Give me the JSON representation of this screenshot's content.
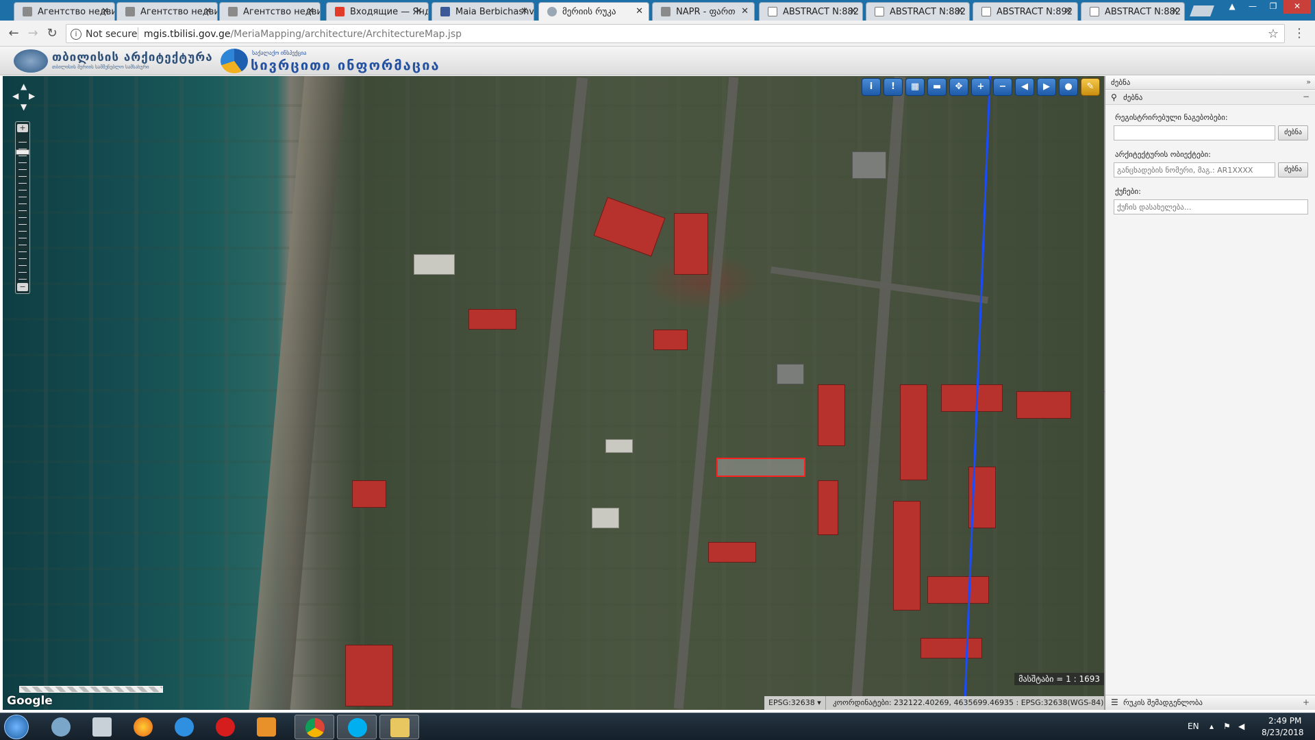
{
  "browser": {
    "tabs": [
      {
        "label": "Агентство недви",
        "icon": "site-icon"
      },
      {
        "label": "Агентство недви",
        "icon": "site-icon"
      },
      {
        "label": "Агентство недви",
        "icon": "site-icon"
      },
      {
        "label": "Входящие — Янд",
        "icon": "yandex-mail-icon"
      },
      {
        "label": "Maia Berbichashv",
        "icon": "facebook-icon"
      },
      {
        "label": "მერიის რუკა",
        "icon": "globe-icon",
        "active": true
      },
      {
        "label": "NAPR - ფართ",
        "icon": "napr-icon"
      },
      {
        "label": "ABSTRACT N:882",
        "icon": "document-icon"
      },
      {
        "label": "ABSTRACT N:882",
        "icon": "document-icon"
      },
      {
        "label": "ABSTRACT N:892",
        "icon": "document-icon"
      },
      {
        "label": "ABSTRACT N:882",
        "icon": "document-icon"
      }
    ],
    "security_label": "Not secure",
    "url_host": "mgis.tbilisi.gov.ge",
    "url_path": "/MeriaMapping/architecture/ArchitectureMap.jsp"
  },
  "app_header": {
    "logo1_title": "თბილისის არქიტექტურა",
    "logo1_subtitle": "თბილისის მერიის სამშენებლო სამსახური",
    "logo2_top": "საქალაქო ინსპექცია",
    "logo2_title": "სივრცითი ინფორმაცია"
  },
  "map": {
    "toolbar": [
      {
        "name": "info-tool-icon",
        "glyph": "i"
      },
      {
        "name": "identify-tool-icon",
        "glyph": "!"
      },
      {
        "name": "measure-area-icon",
        "glyph": "▦"
      },
      {
        "name": "measure-length-icon",
        "glyph": "▬"
      },
      {
        "name": "pan-icon",
        "glyph": "✥"
      },
      {
        "name": "zoom-in-icon",
        "glyph": "+"
      },
      {
        "name": "zoom-out-icon",
        "glyph": "−"
      },
      {
        "name": "zoom-prev-icon",
        "glyph": "◀"
      },
      {
        "name": "zoom-next-icon",
        "glyph": "▶"
      },
      {
        "name": "full-extent-icon",
        "glyph": "●"
      },
      {
        "name": "print-icon",
        "glyph": "✎"
      }
    ],
    "scale_text": "მასშტაბი = 1 : 1693",
    "provider": "Google",
    "epsg_select": "EPSG:32638",
    "coordinates": "კოორდინატები: 232122.40269, 4635699.46935 : EPSG:32638(WGS-84)"
  },
  "side_panel": {
    "title": "ძებნა",
    "subtitle": "ძებნა",
    "fields": [
      {
        "label": "რეგისტრირებული ნაგებობები:",
        "placeholder": "",
        "button": "ძებნა"
      },
      {
        "label": "არქიტექტურის ობიექტები:",
        "placeholder": "განცხადების ნომერი, მაგ.: AR1XXXX",
        "button": "ძებნა"
      },
      {
        "label": "ქუჩები:",
        "placeholder": "ქუჩის დასახელება..."
      }
    ],
    "footer": "რუკის შემადგენლობა"
  },
  "taskbar": {
    "language": "EN",
    "time": "2:49 PM",
    "date": "8/23/2018"
  },
  "colors": {
    "tabbar_bg": "#1d6fa8",
    "parcel_outline": "#ff2020",
    "boundary_line": "#1a4cff",
    "tool_blue": "#1d5aa8"
  }
}
